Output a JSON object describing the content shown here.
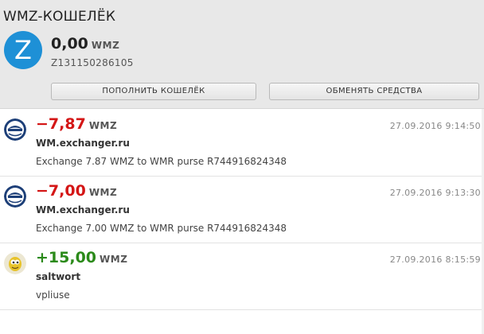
{
  "header": {
    "title": "WMZ-КОШЕЛЁК",
    "avatar_letter": "Z",
    "balance": "0,00",
    "currency": "WMZ",
    "purse_id": "Z131150286105",
    "topup_label": "ПОПОЛНИТЬ КОШЕЛЁК",
    "exchange_label": "ОБМЕНЯТЬ СРЕДСТВА",
    "accent_color": "#1e90d6"
  },
  "transactions": [
    {
      "amount": "−7,87",
      "currency": "WMZ",
      "direction": "outgoing",
      "color": "#d41616",
      "date": "27.09.2016 9:14:50",
      "counterparty": "WM.exchanger.ru",
      "description": "Exchange 7.87 WMZ to WMR purse R744916824348",
      "icon": "wm-exchanger-logo"
    },
    {
      "amount": "−7,00",
      "currency": "WMZ",
      "direction": "outgoing",
      "color": "#d41616",
      "date": "27.09.2016 9:13:30",
      "counterparty": "WM.exchanger.ru",
      "description": "Exchange 7.00 WMZ to WMR purse R744916824348",
      "icon": "wm-exchanger-logo"
    },
    {
      "amount": "+15,00",
      "currency": "WMZ",
      "direction": "incoming",
      "color": "#2b8a1a",
      "date": "27.09.2016 8:15:59",
      "counterparty": "saltwort",
      "description": "vpliuse",
      "icon": "user-avatar-icon"
    }
  ]
}
